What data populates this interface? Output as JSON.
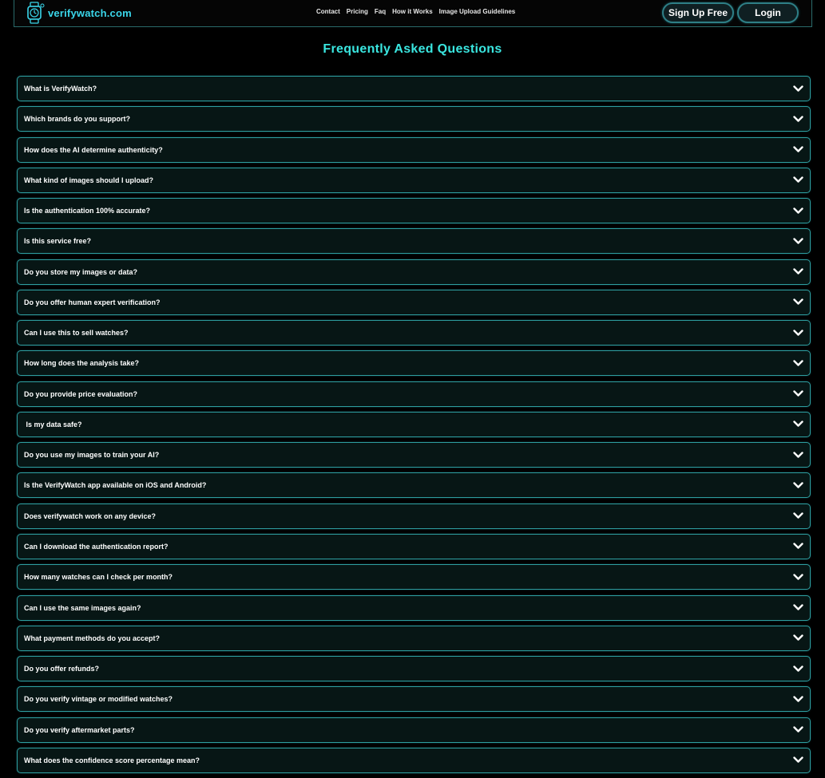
{
  "header": {
    "brand": "verifywatch.com",
    "nav": [
      "Contact",
      "Pricing",
      "Faq",
      "How it Works",
      "Image Upload Guidelines"
    ],
    "signup_label": "Sign Up Free",
    "login_label": "Login"
  },
  "faq": {
    "title": "Frequently Asked Questions",
    "items": [
      "What is VerifyWatch?",
      "Which brands do you support?",
      "How does the AI determine authenticity?",
      "What kind of images should I upload?",
      "Is the authentication 100% accurate?",
      "Is this service free?",
      "Do you store my images or data?",
      "Do you offer human expert verification?",
      "Can I use this to sell watches?",
      "How long does the analysis take?",
      "Do you provide price evaluation?",
      " Is my data safe?",
      "Do you use my images to train your AI?",
      "Is the VerifyWatch app available on iOS and Android?",
      "Does verifywatch work on any device?",
      "Can I download the authentication report?",
      "How many watches can I check per month?",
      "Can I use the same images again?",
      "What payment methods do you accept?",
      "Do you offer refunds?",
      "Do you verify vintage or modified watches?",
      "Do you verify aftermarket parts?",
      "What does the confidence score percentage mean?"
    ]
  },
  "colors": {
    "accent": "#3ae6e0",
    "border": "#2e9ea0",
    "item_bg": "#071615",
    "page_bg": "#000000"
  },
  "icons": {
    "logo": "watch-logo-icon",
    "expand": "chevron-down-icon"
  }
}
